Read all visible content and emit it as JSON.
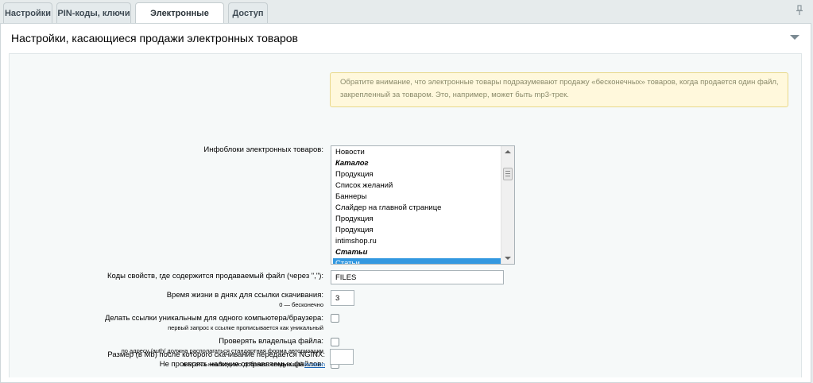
{
  "tabs": [
    "Настройки",
    "PIN-коды, ключи",
    "Электронные товары",
    "Доступ"
  ],
  "panel": {
    "title": "Настройки, касающиеся продажи электронных товаров",
    "notice": "Обратите внимание, что электронные товары подразумевают продажу «бесконечных» товаров, когда продается один файл, закрепленный за товаром. Это, например, может быть mp3-трек."
  },
  "form": {
    "iblocks_label": "Инфоблоки электронных товаров:",
    "iblock_options": [
      {
        "label": "Новости",
        "group": false,
        "selected": false
      },
      {
        "label": "Каталог",
        "group": true,
        "selected": false
      },
      {
        "label": "Продукция",
        "group": false,
        "selected": false
      },
      {
        "label": "Список желаний",
        "group": false,
        "selected": false
      },
      {
        "label": "Баннеры",
        "group": false,
        "selected": false
      },
      {
        "label": "Слайдер на главной странице",
        "group": false,
        "selected": false
      },
      {
        "label": "Продукция",
        "group": false,
        "selected": false
      },
      {
        "label": "Продукция",
        "group": false,
        "selected": false
      },
      {
        "label": "intimshop.ru",
        "group": false,
        "selected": false
      },
      {
        "label": "Статьи",
        "group": true,
        "selected": false
      },
      {
        "label": "Статьи",
        "group": false,
        "selected": true
      }
    ],
    "props_label": "Коды свойств, где содержится продаваемый файл (через \",\"):",
    "props_value": "FILES",
    "lifetime_label": "Время жизни в днях для ссылки скачивания:",
    "lifetime_hint": "0 — бесконечно",
    "lifetime_value": "3",
    "unique_label": "Делать ссылки уникальным для одного компьютера/браузера:",
    "unique_hint": "первый запрос к ссылке прописывается как уникальный",
    "unique_checked": false,
    "owner_label": "Проверять владельца файла:",
    "owner_hint": "по адресу /auth/ должна располагаться стандартная форма авторизации",
    "owner_checked": false,
    "nocheck_label": "Не проверять наличие отправляемых файлов:",
    "nocheck_checked": false,
    "nginx_label": "Размер (в Mb) после которого скачивание передается NGINX:",
    "nginx_hint_prefix": "в NGINX необходимо добавить следующий",
    "nginx_hint_link": "location",
    "nginx_value": ""
  },
  "colors": {
    "selected": "#3398e0",
    "notice_bg": "#fff8dc",
    "link": "#1b66b6"
  }
}
